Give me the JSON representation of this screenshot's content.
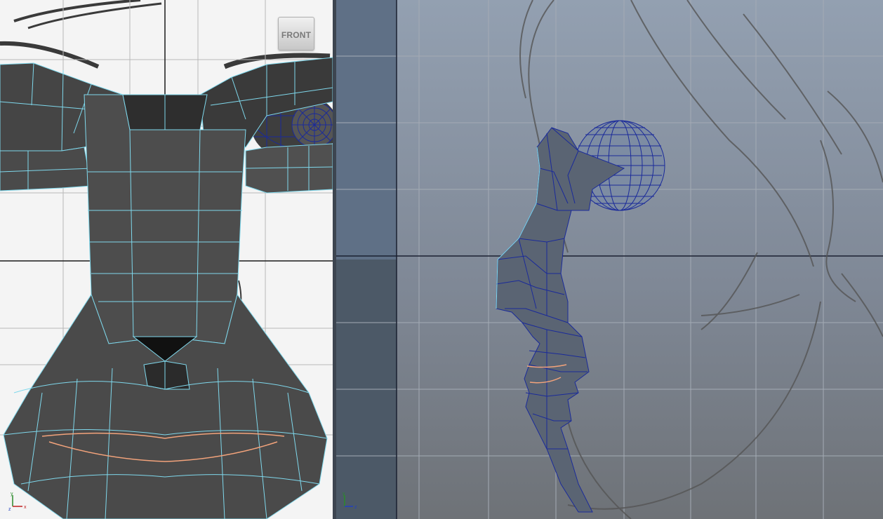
{
  "viewports": {
    "front": {
      "label": "FRONT",
      "background": "#f4f4f4",
      "wire_color": "#7fd8ec"
    },
    "side": {
      "background": "#8a95a5",
      "wire_color": "#1a2a9a"
    }
  },
  "axis_gizmo": {
    "x_label": "x",
    "y_label": "y",
    "z_label": "z"
  },
  "colors": {
    "mesh_face": "#4a4a4a",
    "mesh_dark": "#2a2a2a",
    "lip_edge": "#f3a37b",
    "sketch": "#555555"
  }
}
